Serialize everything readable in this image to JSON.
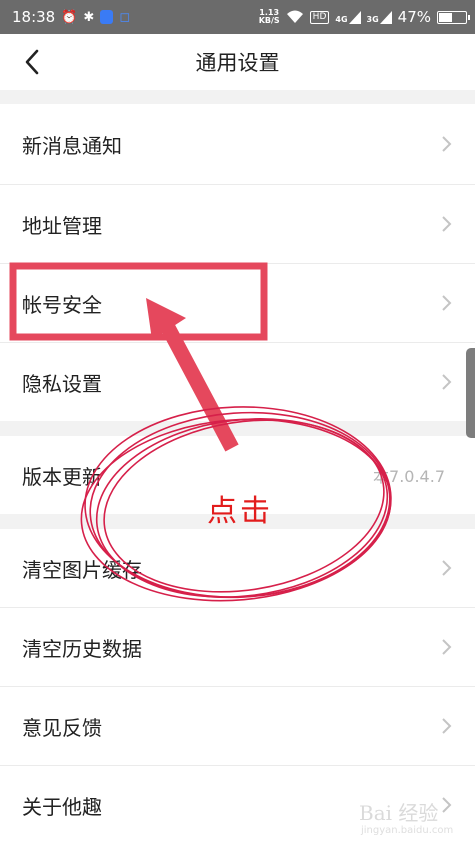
{
  "status_bar": {
    "time": "18:38",
    "net_speed_value": "1.13",
    "net_speed_unit": "KB/S",
    "hd": "HD",
    "signal_1": "4G",
    "signal_2": "3G",
    "battery_percent": "47%",
    "battery_level": 0.47
  },
  "nav": {
    "title": "通用设置"
  },
  "rows": [
    {
      "label": "新消息通知"
    },
    {
      "label": "地址管理"
    },
    {
      "label": "帐号安全"
    },
    {
      "label": "隐私设置"
    },
    {
      "label": "版本更新",
      "value": "本7.0.4.7"
    },
    {
      "label": "清空图片缓存"
    },
    {
      "label": "清空历史数据"
    },
    {
      "label": "意见反馈"
    },
    {
      "label": "关于他趣"
    }
  ],
  "annotation": {
    "text": "点击",
    "color": "#e5485d"
  },
  "watermark": {
    "brand": "Bai 经验",
    "url": "jingyan.baidu.com"
  },
  "colors": {
    "status_bg": "#6b6b6b",
    "gap_bg": "#f2f2f2",
    "chevron": "#c4c4c4",
    "annotation_text": "#e21c1c"
  }
}
